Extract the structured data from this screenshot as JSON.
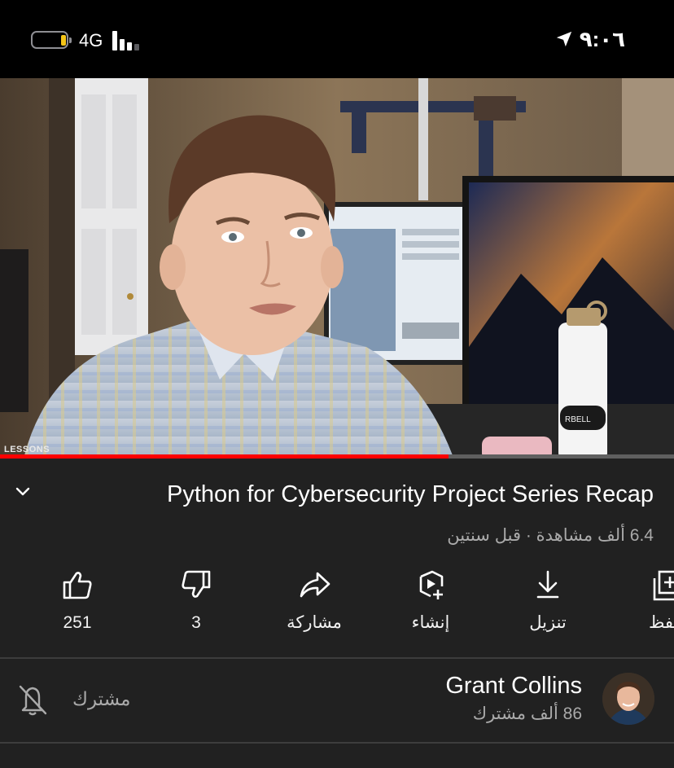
{
  "status_bar": {
    "network": "4G",
    "time": "٩:٠٦",
    "battery_level": 0.15,
    "battery_color": "#f5c518",
    "location_icon": "location-arrow-icon"
  },
  "video": {
    "overlay_text": "LESSONS",
    "progress": 0.665,
    "progress_color": "#ff0000"
  },
  "details": {
    "title": "Python for Cybersecurity Project Series Recap",
    "meta": "6.4 ألف مشاهدة · قبل سنتين",
    "collapse_icon": "chevron-down-icon"
  },
  "actions": {
    "like": {
      "icon": "thumbs-up-icon",
      "label": "251"
    },
    "dislike": {
      "icon": "thumbs-down-icon",
      "label": "3"
    },
    "share": {
      "icon": "share-arrow-icon",
      "label": "مشاركة"
    },
    "create": {
      "icon": "create-clip-icon",
      "label": "إنشاء"
    },
    "download": {
      "icon": "download-icon",
      "label": "تنزيل"
    },
    "save": {
      "icon": "save-playlist-icon",
      "label": "حفظ"
    }
  },
  "channel": {
    "name": "Grant Collins",
    "subscribers": "86 ألف مشترك",
    "subscribed_label": "مشترك",
    "bell_icon": "bell-off-icon"
  },
  "colors": {
    "background": "#212121",
    "secondary_text": "#aaaaaa"
  }
}
